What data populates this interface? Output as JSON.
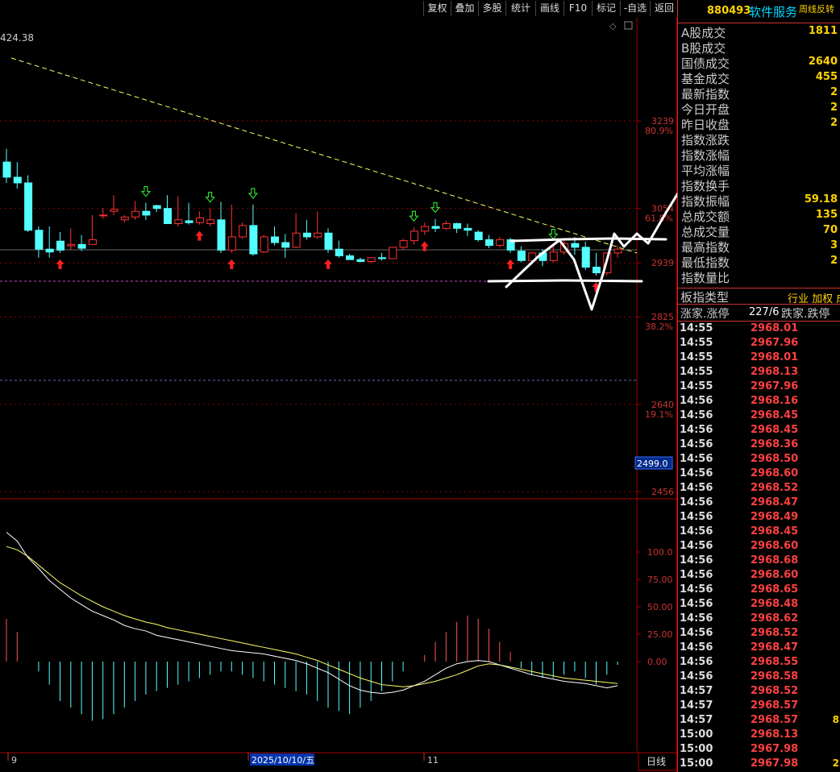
{
  "toolbar": {
    "buttons": [
      "复权",
      "叠加",
      "多股",
      "统计",
      "画线",
      "F10",
      "标记",
      "-自选",
      "返回"
    ]
  },
  "header": {
    "code": "880493",
    "name": "软件服务",
    "mode": "周线反转"
  },
  "chart": {
    "top_left_value": "424.38",
    "price_labels": [
      {
        "price": "3239",
        "pct": "80.9%"
      },
      {
        "price": "3054",
        "pct": "61.8%"
      },
      {
        "price": "2939",
        "pct": ""
      },
      {
        "price": "2825",
        "pct": "38.2%"
      },
      {
        "price": "2640",
        "pct": "19.1%"
      },
      {
        "price": "2456",
        "pct": ""
      }
    ],
    "price_box": "2499.0",
    "macd_labels": [
      "100.0",
      "75.00",
      "50.00",
      "25.00",
      "0.00"
    ],
    "date_marks": [
      "9",
      "2025/10/10/五",
      "11"
    ],
    "period_button": "日线",
    "colors": {
      "up": "#ff3333",
      "down": "#54ffff",
      "dif": "#ffffff",
      "dea": "#ffff66",
      "grid": "#8b0000"
    }
  },
  "chart_data": {
    "type": "candlestick",
    "ohlc": [
      [
        3152,
        3180,
        3120,
        3108
      ],
      [
        3120,
        3152,
        3108,
        3096
      ],
      [
        3108,
        3124,
        3008,
        3004
      ],
      [
        3008,
        3016,
        2968,
        2950
      ],
      [
        2968,
        3016,
        2962,
        2950
      ],
      [
        2985,
        3004,
        2966,
        2960
      ],
      [
        2975,
        3012,
        2978,
        2966
      ],
      [
        2978,
        2998,
        2970,
        2964
      ],
      [
        2978,
        3040,
        2988,
        2978
      ],
      [
        3040,
        3055,
        3040,
        3032
      ],
      [
        3048,
        3082,
        3052,
        3040
      ],
      [
        3030,
        3040,
        3036,
        3024
      ],
      [
        3036,
        3070,
        3048,
        3030
      ],
      [
        3048,
        3066,
        3040,
        3030
      ],
      [
        3060,
        3062,
        3054,
        3046
      ],
      [
        3054,
        3082,
        3022,
        3022
      ],
      [
        3022,
        3080,
        3030,
        3016
      ],
      [
        3028,
        3066,
        3024,
        3020
      ],
      [
        3024,
        3048,
        3034,
        3020
      ],
      [
        3022,
        3054,
        3030,
        3016
      ],
      [
        3030,
        3068,
        2966,
        2960
      ],
      [
        2966,
        3062,
        2994,
        2960
      ],
      [
        2994,
        3024,
        3018,
        2990
      ],
      [
        3018,
        3062,
        2958,
        2954
      ],
      [
        2962,
        2998,
        2994,
        2960
      ],
      [
        2994,
        3016,
        2982,
        2976
      ],
      [
        2982,
        3000,
        2972,
        2950
      ],
      [
        2972,
        3044,
        3002,
        2970
      ],
      [
        3002,
        3030,
        2994,
        2988
      ],
      [
        2994,
        3048,
        3002,
        2990
      ],
      [
        3002,
        3012,
        2968,
        2960
      ],
      [
        2968,
        2986,
        2954,
        2950
      ],
      [
        2954,
        2958,
        2946,
        2946
      ],
      [
        2946,
        2950,
        2942,
        2940
      ],
      [
        2942,
        2948,
        2950,
        2938
      ],
      [
        2950,
        2960,
        2948,
        2944
      ],
      [
        2948,
        2966,
        2972,
        2948
      ],
      [
        2972,
        2990,
        2986,
        2966
      ],
      [
        2986,
        3014,
        3006,
        2978
      ],
      [
        3006,
        3024,
        3016,
        2998
      ],
      [
        3016,
        3032,
        3012,
        3004
      ],
      [
        3012,
        3028,
        3022,
        3008
      ],
      [
        3022,
        3024,
        3012,
        3002
      ],
      [
        3012,
        3022,
        3008,
        2996
      ],
      [
        3004,
        3008,
        2988,
        2984
      ],
      [
        2988,
        2998,
        2976,
        2970
      ],
      [
        2976,
        2994,
        2988,
        2972
      ],
      [
        2988,
        2992,
        2966,
        2960
      ],
      [
        2964,
        2974,
        2944,
        2940
      ],
      [
        2944,
        2962,
        2960,
        2940
      ],
      [
        2960,
        2968,
        2944,
        2932
      ],
      [
        2944,
        2976,
        2962,
        2940
      ],
      [
        2962,
        2988,
        2980,
        2956
      ],
      [
        2980,
        2994,
        2972,
        2956
      ],
      [
        2972,
        2984,
        2930,
        2924
      ],
      [
        2930,
        2960,
        2918,
        2912
      ],
      [
        2918,
        2936,
        2960,
        2912
      ],
      [
        2960,
        2976,
        2968,
        2950
      ]
    ],
    "macd_dif": [
      118,
      110,
      95,
      85,
      74,
      66,
      58,
      52,
      46,
      42,
      38,
      33,
      30,
      28,
      24,
      22,
      20,
      18,
      16,
      14,
      12,
      10,
      9,
      8,
      7,
      5,
      3,
      1,
      -2,
      -6,
      -10,
      -16,
      -22,
      -26,
      -28,
      -29,
      -28,
      -26,
      -22,
      -18,
      -12,
      -6,
      -2,
      0,
      1,
      0,
      -3,
      -6,
      -9,
      -12,
      -14,
      -16,
      -18,
      -19,
      -20,
      -22,
      -24,
      -22
    ],
    "macd_dea": [
      105,
      102,
      96,
      88,
      80,
      72,
      66,
      60,
      55,
      50,
      46,
      42,
      39,
      36,
      34,
      31,
      29,
      27,
      25,
      23,
      21,
      19,
      17,
      15,
      13,
      11,
      9,
      7,
      4,
      1,
      -3,
      -7,
      -11,
      -15,
      -18,
      -21,
      -22,
      -23,
      -22,
      -20,
      -18,
      -15,
      -12,
      -8,
      -4,
      -2,
      -3,
      -5,
      -7,
      -9,
      -11,
      -13,
      -15,
      -16,
      -17,
      -18,
      -19,
      -20
    ],
    "macd_hist": [
      26,
      18,
      0,
      -6,
      -14,
      -24,
      -28,
      -32,
      -36,
      -35,
      -32,
      -28,
      -24,
      -20,
      -18,
      -16,
      -14,
      -12,
      -10,
      -8,
      -6,
      -6,
      -8,
      -10,
      -12,
      -14,
      -16,
      -18,
      -20,
      -24,
      -28,
      -30,
      -32,
      -28,
      -24,
      -18,
      -12,
      -6,
      0,
      4,
      12,
      18,
      24,
      28,
      26,
      20,
      12,
      6,
      -4,
      -8,
      -10,
      -10,
      -8,
      -6,
      -10,
      -14,
      -8,
      -2
    ]
  },
  "right_panel": {
    "stats": [
      {
        "label": "A股成交",
        "value": "1811"
      },
      {
        "label": "B股成交",
        "value": ""
      },
      {
        "label": "国债成交",
        "value": "2640"
      },
      {
        "label": "基金成交",
        "value": "455"
      },
      {
        "label": "最新指数",
        "value": "2"
      },
      {
        "label": "今日开盘",
        "value": "2"
      },
      {
        "label": "昨日收盘",
        "value": "2"
      },
      {
        "label": "指数涨跌",
        "value": ""
      },
      {
        "label": "指数涨幅",
        "value": ""
      },
      {
        "label": "平均涨幅",
        "value": ""
      },
      {
        "label": "指数换手",
        "value": ""
      },
      {
        "label": "指数振幅",
        "value": "59.18"
      },
      {
        "label": "总成交额",
        "value": "135"
      },
      {
        "label": "总成交量",
        "value": "70"
      },
      {
        "label": "最高指数",
        "value": "3"
      },
      {
        "label": "最低指数",
        "value": "2"
      },
      {
        "label": "指数量比",
        "value": ""
      }
    ],
    "board_type_label": "板指类型",
    "board_type_value": "行业 加权 成",
    "updown_label": "涨家.涨停",
    "updown_value": "227/6",
    "down_label": "跌家.跌停",
    "ticks": [
      {
        "time": "14:55",
        "price": "2968.01",
        "extra": ""
      },
      {
        "time": "14:55",
        "price": "2967.96",
        "extra": ""
      },
      {
        "time": "14:55",
        "price": "2968.01",
        "extra": ""
      },
      {
        "time": "14:55",
        "price": "2968.13",
        "extra": ""
      },
      {
        "time": "14:55",
        "price": "2967.96",
        "extra": ""
      },
      {
        "time": "14:56",
        "price": "2968.16",
        "extra": ""
      },
      {
        "time": "14:56",
        "price": "2968.45",
        "extra": ""
      },
      {
        "time": "14:56",
        "price": "2968.45",
        "extra": ""
      },
      {
        "time": "14:56",
        "price": "2968.36",
        "extra": ""
      },
      {
        "time": "14:56",
        "price": "2968.50",
        "extra": ""
      },
      {
        "time": "14:56",
        "price": "2968.60",
        "extra": ""
      },
      {
        "time": "14:56",
        "price": "2968.52",
        "extra": ""
      },
      {
        "time": "14:56",
        "price": "2968.47",
        "extra": ""
      },
      {
        "time": "14:56",
        "price": "2968.49",
        "extra": ""
      },
      {
        "time": "14:56",
        "price": "2968.45",
        "extra": ""
      },
      {
        "time": "14:56",
        "price": "2968.60",
        "extra": ""
      },
      {
        "time": "14:56",
        "price": "2968.68",
        "extra": ""
      },
      {
        "time": "14:56",
        "price": "2968.60",
        "extra": ""
      },
      {
        "time": "14:56",
        "price": "2968.65",
        "extra": ""
      },
      {
        "time": "14:56",
        "price": "2968.48",
        "extra": ""
      },
      {
        "time": "14:56",
        "price": "2968.62",
        "extra": ""
      },
      {
        "time": "14:56",
        "price": "2968.52",
        "extra": ""
      },
      {
        "time": "14:56",
        "price": "2968.47",
        "extra": ""
      },
      {
        "time": "14:56",
        "price": "2968.55",
        "extra": ""
      },
      {
        "time": "14:56",
        "price": "2968.58",
        "extra": ""
      },
      {
        "time": "14:57",
        "price": "2968.52",
        "extra": ""
      },
      {
        "time": "14:57",
        "price": "2968.57",
        "extra": ""
      },
      {
        "time": "14:57",
        "price": "2968.57",
        "extra": "8"
      },
      {
        "time": "15:00",
        "price": "2968.13",
        "extra": ""
      },
      {
        "time": "15:00",
        "price": "2967.98",
        "extra": ""
      },
      {
        "time": "15:00",
        "price": "2967.98",
        "extra": "2"
      }
    ]
  }
}
